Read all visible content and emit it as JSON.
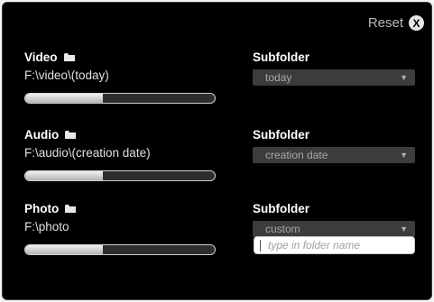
{
  "header": {
    "reset_label": "Reset",
    "reset_icon": "X"
  },
  "sections": [
    {
      "title": "Video",
      "path": "F:\\video\\(today)",
      "progress": 0.41,
      "subfolder_label": "Subfolder",
      "subfolder_value": "today"
    },
    {
      "title": "Audio",
      "path": "F:\\audio\\(creation date)",
      "progress": 0.41,
      "subfolder_label": "Subfolder",
      "subfolder_value": "creation date"
    },
    {
      "title": "Photo",
      "path": "F:\\photo",
      "progress": 0.41,
      "subfolder_label": "Subfolder",
      "subfolder_value": "custom",
      "folder_name_placeholder": "type in folder name"
    }
  ],
  "colors": {
    "background": "#000000",
    "text": "#ffffff",
    "dropdown": "#3c3c3c",
    "bar_fill": "#d8d8d8"
  }
}
